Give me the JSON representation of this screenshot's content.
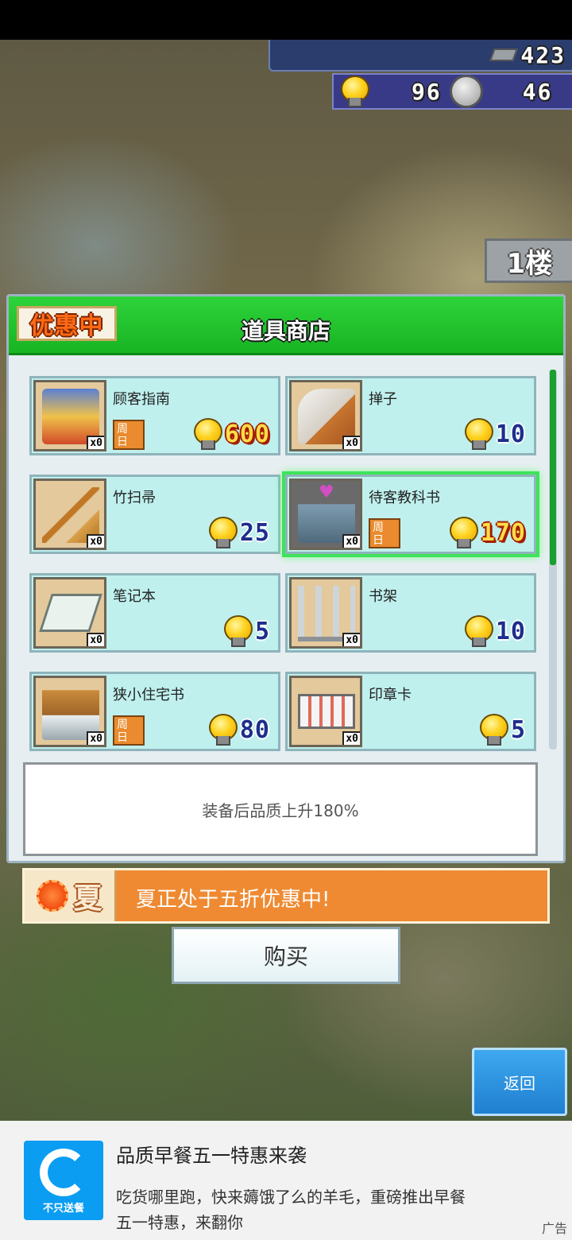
{
  "hud": {
    "tickets": "423",
    "bulbs": "96",
    "silver": "46"
  },
  "floor_label": "1楼",
  "shop": {
    "sale_badge": "优惠中",
    "title": "道具商店",
    "items": [
      {
        "name": "顾客指南",
        "count": "x0",
        "price": "600",
        "weekday": "周\n日",
        "on_sale": true
      },
      {
        "name": "掸子",
        "count": "x0",
        "price": "10",
        "weekday": "",
        "on_sale": false
      },
      {
        "name": "竹扫帚",
        "count": "x0",
        "price": "25",
        "weekday": "",
        "on_sale": false
      },
      {
        "name": "待客教科书",
        "count": "x0",
        "price": "170",
        "weekday": "周\n日",
        "on_sale": true,
        "selected": true
      },
      {
        "name": "笔记本",
        "count": "x0",
        "price": "5",
        "weekday": "",
        "on_sale": false
      },
      {
        "name": "书架",
        "count": "x0",
        "price": "10",
        "weekday": "",
        "on_sale": false
      },
      {
        "name": "狭小住宅书",
        "count": "x0",
        "price": "80",
        "weekday": "周\n日",
        "on_sale": false
      },
      {
        "name": "印章卡",
        "count": "x0",
        "price": "5",
        "weekday": "",
        "on_sale": false
      }
    ],
    "description": "装备后品质上升180%"
  },
  "season": {
    "icon_char": "夏",
    "message": "夏正处于五折优惠中!"
  },
  "buttons": {
    "buy": "购买",
    "back": "返回"
  },
  "ad": {
    "logo_label": "不只送餐",
    "title": "品质早餐五一特惠来袭",
    "body": "吃货哪里跑，快来薅饿了么的羊毛，重磅推出早餐五一特惠，来翻你",
    "mark": "广告"
  },
  "colors": {
    "header_green": "#1fbf2a",
    "card_bg": "#bff0ee",
    "season_orange": "#ef8a32",
    "back_blue": "#2a90dc"
  }
}
